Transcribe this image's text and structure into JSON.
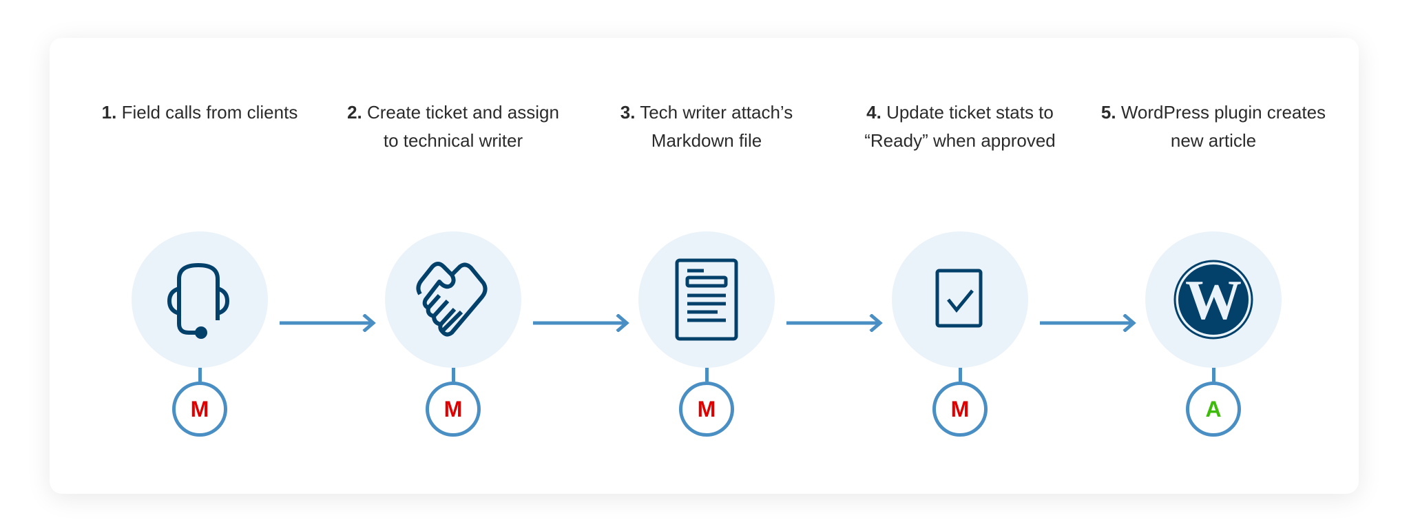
{
  "steps": [
    {
      "number": "1.",
      "text": "Field calls from clients",
      "icon": "headset-icon",
      "badge": "M",
      "badge_color": "#E00000"
    },
    {
      "number": "2.",
      "text": "Create ticket and assign to technical writer",
      "icon": "handshake-icon",
      "badge": "M",
      "badge_color": "#E00000"
    },
    {
      "number": "3.",
      "text": "Tech writer attach’s Markdown file",
      "icon": "document-icon",
      "badge": "M",
      "badge_color": "#E00000"
    },
    {
      "number": "4.",
      "text": "Update ticket stats to “Ready” when approved",
      "icon": "checkbox-icon",
      "badge": "M",
      "badge_color": "#E00000"
    },
    {
      "number": "5.",
      "text": "WordPress plugin creates new article",
      "icon": "wordpress-icon",
      "badge": "A",
      "badge_color": "#3DBB0A"
    }
  ],
  "colors": {
    "icon": "#03406A",
    "circle": "#EBF3FA",
    "connector": "#4A8FC4"
  }
}
